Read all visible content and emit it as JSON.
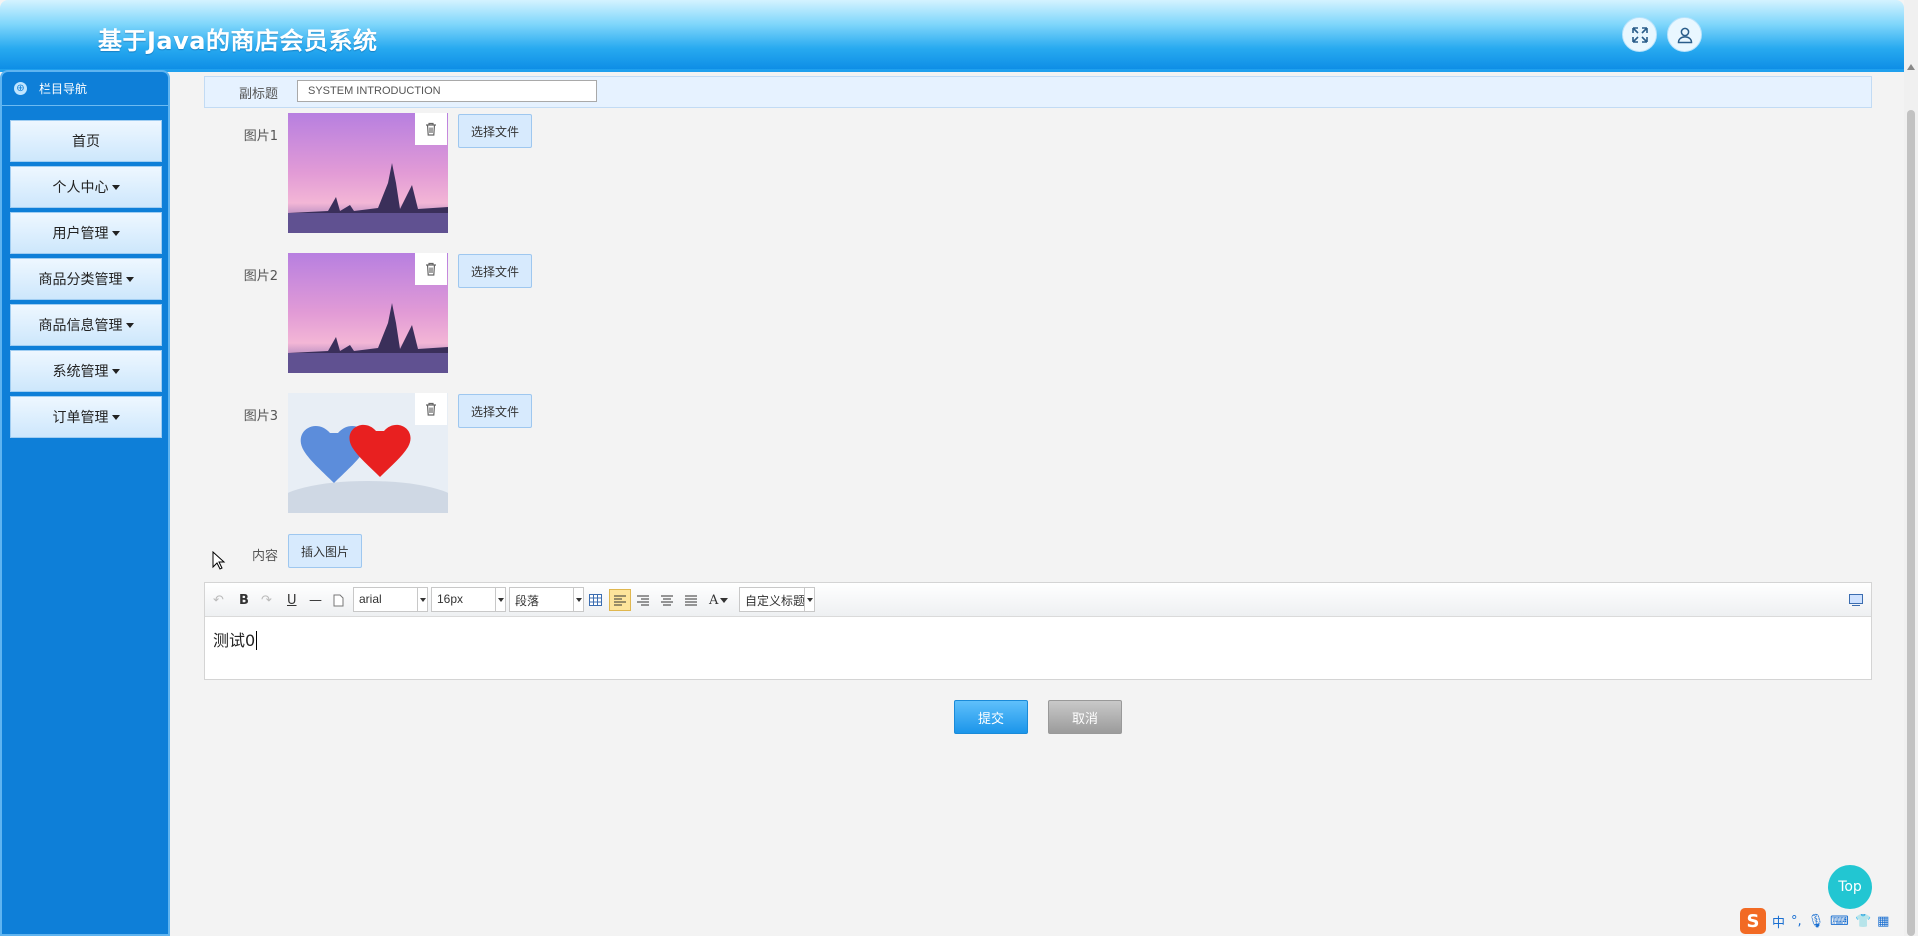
{
  "header": {
    "title": "基于Java的商店会员系统",
    "fullscreen_icon": "expand-arrows-icon",
    "user_icon": "user-icon"
  },
  "sidebar": {
    "title": "栏目导航",
    "items": [
      {
        "label": "首页",
        "has_caret": false
      },
      {
        "label": "个人中心",
        "has_caret": true
      },
      {
        "label": "用户管理",
        "has_caret": true
      },
      {
        "label": "商品分类管理",
        "has_caret": true
      },
      {
        "label": "商品信息管理",
        "has_caret": true
      },
      {
        "label": "系统管理",
        "has_caret": true
      },
      {
        "label": "订单管理",
        "has_caret": true
      }
    ]
  },
  "form": {
    "subtitle_label": "副标题",
    "subtitle_value": "SYSTEM INTRODUCTION",
    "image1_label": "图片1",
    "image2_label": "图片2",
    "image3_label": "图片3",
    "choose_file": "选择文件",
    "content_label": "内容",
    "insert_image": "插入图片"
  },
  "editor": {
    "font_family": "arial",
    "font_size": "16px",
    "paragraph": "段落",
    "custom_title": "自定义标题",
    "bold": "B",
    "underline": "U",
    "font_color": "A",
    "body_text": "测试0"
  },
  "actions": {
    "submit": "提交",
    "cancel": "取消"
  },
  "back_to_top": "Top",
  "ime": {
    "lang": "中"
  },
  "colors": {
    "sidebar_bg": "#0e7fd8",
    "accent": "#1b95ea",
    "top_button": "#22c6d2"
  }
}
